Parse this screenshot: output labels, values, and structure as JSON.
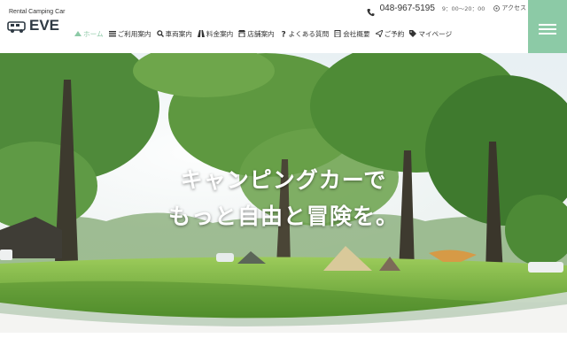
{
  "brand": {
    "subtitle": "Rental Camping Car",
    "name": "EVE",
    "logo_icon": "camper-van-icon"
  },
  "topbar": {
    "phone": "048-967-5195",
    "hours": "9：00〜20：00",
    "access_label": "アクセス",
    "phone_icon": "phone-icon",
    "access_icon": "pin-icon"
  },
  "nav": {
    "items": [
      {
        "label": "ホーム",
        "icon": "tent-icon",
        "active": true
      },
      {
        "label": "ご利用案内",
        "icon": "list-icon",
        "active": false
      },
      {
        "label": "車両案内",
        "icon": "search-icon",
        "active": false
      },
      {
        "label": "料金案内",
        "icon": "road-icon",
        "active": false
      },
      {
        "label": "店舗案内",
        "icon": "shop-icon",
        "active": false
      },
      {
        "label": "よくある質問",
        "icon": "question-icon",
        "active": false
      },
      {
        "label": "会社概要",
        "icon": "building-icon",
        "active": false
      },
      {
        "label": "ご予約",
        "icon": "send-icon",
        "active": false
      },
      {
        "label": "マイページ",
        "icon": "tag-icon",
        "active": false
      }
    ]
  },
  "menu_button_icon": "hamburger-icon",
  "hero": {
    "line1": "キャンピングカーで",
    "line2": "もっと自由と冒険を。"
  },
  "colors": {
    "accent": "#8ccaa6",
    "text": "#333333",
    "grass": "#6fae3d"
  }
}
